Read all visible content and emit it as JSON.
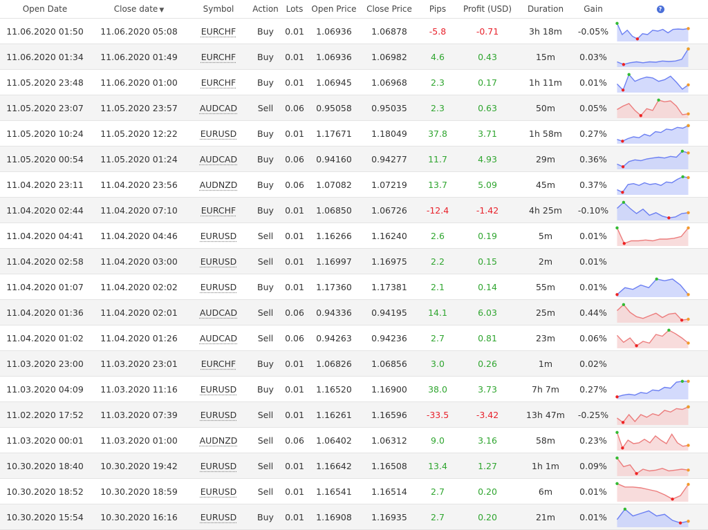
{
  "headers": {
    "open_date": "Open Date",
    "close_date": "Close date",
    "close_sort_icon": "triangle-down",
    "symbol": "Symbol",
    "action": "Action",
    "lots": "Lots",
    "open_price": "Open Price",
    "close_price": "Close Price",
    "pips": "Pips",
    "profit": "Profit (USD)",
    "duration": "Duration",
    "gain": "Gain",
    "help_icon": "?"
  },
  "colors": {
    "positive": "#2fa52f",
    "negative": "#e8212b",
    "buy_line": "#6b7ff2",
    "buy_fill": "#c4cdfb",
    "sell_line": "#ec7c7c",
    "sell_fill": "#f6d0d0",
    "start_marker_buy": "#ee3333",
    "high_marker": "#33bb33",
    "low_marker": "#ee2222",
    "end_marker": "#f39a2c"
  },
  "trades": [
    {
      "open": "11.06.2020 01:50",
      "close": "11.06.2020 05:08",
      "symbol": "EURCHF",
      "action": "Buy",
      "lots": "0.01",
      "open_price": "1.06936",
      "close_price": "1.06878",
      "pips": "-5.8",
      "profit": "-0.71",
      "duration": "3h 18m",
      "gain": "-0.05%",
      "spark": [
        0.95,
        0.3,
        0.55,
        0.2,
        0.05,
        0.35,
        0.3,
        0.55,
        0.5,
        0.6,
        0.4,
        0.6,
        0.62,
        0.6,
        0.65
      ]
    },
    {
      "open": "11.06.2020 01:34",
      "close": "11.06.2020 01:49",
      "symbol": "EURCHF",
      "action": "Buy",
      "lots": "0.01",
      "open_price": "1.06936",
      "close_price": "1.06982",
      "pips": "4.6",
      "profit": "0.43",
      "duration": "15m",
      "gain": "0.03%",
      "spark": [
        0.2,
        0.05,
        0.15,
        0.2,
        0.15,
        0.2,
        0.18,
        0.25,
        0.22,
        0.25,
        0.35,
        0.95
      ]
    },
    {
      "open": "11.05.2020 23:48",
      "close": "11.06.2020 01:00",
      "symbol": "EURCHF",
      "action": "Buy",
      "lots": "0.01",
      "open_price": "1.06945",
      "close_price": "1.06968",
      "pips": "2.3",
      "profit": "0.17",
      "duration": "1h 11m",
      "gain": "0.01%",
      "spark": [
        0.4,
        0.05,
        0.95,
        0.55,
        0.7,
        0.8,
        0.75,
        0.55,
        0.65,
        0.85,
        0.5,
        0.1,
        0.35
      ]
    },
    {
      "open": "11.05.2020 23:07",
      "close": "11.05.2020 23:57",
      "symbol": "AUDCAD",
      "action": "Sell",
      "lots": "0.06",
      "open_price": "0.95058",
      "close_price": "0.95035",
      "pips": "2.3",
      "profit": "0.63",
      "duration": "50m",
      "gain": "0.05%",
      "spark": [
        0.4,
        0.6,
        0.75,
        0.35,
        0.05,
        0.45,
        0.35,
        0.95,
        0.85,
        0.9,
        0.6,
        0.1,
        0.15
      ]
    },
    {
      "open": "11.05.2020 10:24",
      "close": "11.05.2020 12:22",
      "symbol": "EURUSD",
      "action": "Buy",
      "lots": "0.01",
      "open_price": "1.17671",
      "close_price": "1.18049",
      "pips": "37.8",
      "profit": "3.71",
      "duration": "1h 58m",
      "gain": "0.27%",
      "spark": [
        0.15,
        0.05,
        0.2,
        0.3,
        0.25,
        0.45,
        0.35,
        0.6,
        0.55,
        0.75,
        0.7,
        0.85,
        0.8,
        0.95
      ]
    },
    {
      "open": "11.05.2020 00:54",
      "close": "11.05.2020 01:24",
      "symbol": "AUDCAD",
      "action": "Buy",
      "lots": "0.06",
      "open_price": "0.94160",
      "close_price": "0.94277",
      "pips": "11.7",
      "profit": "4.93",
      "duration": "29m",
      "gain": "0.36%",
      "spark": [
        0.2,
        0.05,
        0.35,
        0.45,
        0.4,
        0.5,
        0.55,
        0.6,
        0.55,
        0.65,
        0.6,
        0.95,
        0.85
      ]
    },
    {
      "open": "11.04.2020 23:11",
      "close": "11.04.2020 23:56",
      "symbol": "AUDNZD",
      "action": "Buy",
      "lots": "0.06",
      "open_price": "1.07082",
      "close_price": "1.07219",
      "pips": "13.7",
      "profit": "5.09",
      "duration": "45m",
      "gain": "0.37%",
      "spark": [
        0.2,
        0.05,
        0.5,
        0.55,
        0.45,
        0.6,
        0.5,
        0.55,
        0.45,
        0.65,
        0.6,
        0.8,
        0.95,
        0.9
      ]
    },
    {
      "open": "11.04.2020 02:44",
      "close": "11.04.2020 07:10",
      "symbol": "EURCHF",
      "action": "Buy",
      "lots": "0.01",
      "open_price": "1.06850",
      "close_price": "1.06726",
      "pips": "-12.4",
      "profit": "-1.42",
      "duration": "4h 25m",
      "gain": "-0.10%",
      "spark": [
        0.6,
        0.95,
        0.6,
        0.3,
        0.55,
        0.2,
        0.35,
        0.15,
        0.05,
        0.1,
        0.3,
        0.35
      ]
    },
    {
      "open": "11.04.2020 04:41",
      "close": "11.04.2020 04:46",
      "symbol": "EURUSD",
      "action": "Sell",
      "lots": "0.01",
      "open_price": "1.16266",
      "close_price": "1.16240",
      "pips": "2.6",
      "profit": "0.19",
      "duration": "5m",
      "gain": "0.01%",
      "spark": [
        0.95,
        0.05,
        0.2,
        0.2,
        0.25,
        0.2,
        0.3,
        0.3,
        0.35,
        0.45,
        0.95
      ]
    },
    {
      "open": "11.04.2020 02:58",
      "close": "11.04.2020 03:00",
      "symbol": "EURUSD",
      "action": "Sell",
      "lots": "0.01",
      "open_price": "1.16997",
      "close_price": "1.16975",
      "pips": "2.2",
      "profit": "0.15",
      "duration": "2m",
      "gain": "0.01%",
      "spark": null
    },
    {
      "open": "11.04.2020 01:07",
      "close": "11.04.2020 02:02",
      "symbol": "EURUSD",
      "action": "Buy",
      "lots": "0.01",
      "open_price": "1.17360",
      "close_price": "1.17381",
      "pips": "2.1",
      "profit": "0.14",
      "duration": "55m",
      "gain": "0.01%",
      "spark": [
        0.05,
        0.45,
        0.35,
        0.6,
        0.45,
        0.95,
        0.85,
        0.95,
        0.6,
        0.05
      ]
    },
    {
      "open": "11.04.2020 01:36",
      "close": "11.04.2020 02:01",
      "symbol": "AUDCAD",
      "action": "Sell",
      "lots": "0.06",
      "open_price": "0.94336",
      "close_price": "0.94195",
      "pips": "14.1",
      "profit": "6.03",
      "duration": "25m",
      "gain": "0.44%",
      "spark": [
        0.6,
        0.95,
        0.5,
        0.25,
        0.15,
        0.3,
        0.45,
        0.2,
        0.4,
        0.45,
        0.05,
        0.1
      ]
    },
    {
      "open": "11.04.2020 01:02",
      "close": "11.04.2020 01:26",
      "symbol": "AUDCAD",
      "action": "Sell",
      "lots": "0.06",
      "open_price": "0.94263",
      "close_price": "0.94236",
      "pips": "2.7",
      "profit": "0.81",
      "duration": "23m",
      "gain": "0.06%",
      "spark": [
        0.65,
        0.25,
        0.5,
        0.05,
        0.3,
        0.2,
        0.7,
        0.6,
        0.95,
        0.75,
        0.5,
        0.2
      ]
    },
    {
      "open": "11.03.2020 23:00",
      "close": "11.03.2020 23:01",
      "symbol": "EURCHF",
      "action": "Buy",
      "lots": "0.01",
      "open_price": "1.06826",
      "close_price": "1.06856",
      "pips": "3.0",
      "profit": "0.26",
      "duration": "1m",
      "gain": "0.02%",
      "spark": null
    },
    {
      "open": "11.03.2020 04:09",
      "close": "11.03.2020 11:16",
      "symbol": "EURUSD",
      "action": "Buy",
      "lots": "0.01",
      "open_price": "1.16520",
      "close_price": "1.16900",
      "pips": "38.0",
      "profit": "3.73",
      "duration": "7h 7m",
      "gain": "0.27%",
      "spark": [
        0.05,
        0.15,
        0.2,
        0.15,
        0.3,
        0.25,
        0.45,
        0.4,
        0.6,
        0.55,
        0.9,
        0.95,
        0.95
      ]
    },
    {
      "open": "11.02.2020 17:52",
      "close": "11.03.2020 07:39",
      "symbol": "EURUSD",
      "action": "Sell",
      "lots": "0.01",
      "open_price": "1.16261",
      "close_price": "1.16596",
      "pips": "-33.5",
      "profit": "-3.42",
      "duration": "13h 47m",
      "gain": "-0.25%",
      "spark": [
        0.3,
        0.05,
        0.5,
        0.1,
        0.5,
        0.35,
        0.55,
        0.45,
        0.75,
        0.65,
        0.85,
        0.8,
        0.95
      ]
    },
    {
      "open": "11.03.2020 00:01",
      "close": "11.03.2020 01:00",
      "symbol": "AUDNZD",
      "action": "Sell",
      "lots": "0.06",
      "open_price": "1.06402",
      "close_price": "1.06312",
      "pips": "9.0",
      "profit": "3.16",
      "duration": "58m",
      "gain": "0.23%",
      "spark": [
        0.95,
        0.05,
        0.5,
        0.3,
        0.35,
        0.55,
        0.35,
        0.75,
        0.5,
        0.3,
        0.85,
        0.35,
        0.15,
        0.2
      ]
    },
    {
      "open": "10.30.2020 18:40",
      "close": "10.30.2020 19:42",
      "symbol": "EURUSD",
      "action": "Sell",
      "lots": "0.01",
      "open_price": "1.16642",
      "close_price": "1.16508",
      "pips": "13.4",
      "profit": "1.27",
      "duration": "1h 1m",
      "gain": "0.09%",
      "spark": [
        0.95,
        0.45,
        0.55,
        0.05,
        0.3,
        0.2,
        0.25,
        0.35,
        0.2,
        0.25,
        0.3,
        0.25
      ]
    },
    {
      "open": "10.30.2020 18:52",
      "close": "10.30.2020 18:59",
      "symbol": "EURUSD",
      "action": "Sell",
      "lots": "0.01",
      "open_price": "1.16541",
      "close_price": "1.16514",
      "pips": "2.7",
      "profit": "0.20",
      "duration": "6m",
      "gain": "0.01%",
      "spark": [
        0.95,
        0.75,
        0.75,
        0.7,
        0.6,
        0.5,
        0.3,
        0.05,
        0.25,
        0.9
      ]
    },
    {
      "open": "10.30.2020 15:54",
      "close": "10.30.2020 16:16",
      "symbol": "EURUSD",
      "action": "Buy",
      "lots": "0.01",
      "open_price": "1.16908",
      "close_price": "1.16935",
      "pips": "2.7",
      "profit": "0.20",
      "duration": "21m",
      "gain": "0.01%",
      "spark": [
        0.35,
        0.95,
        0.55,
        0.7,
        0.85,
        0.55,
        0.65,
        0.3,
        0.15,
        0.25
      ]
    }
  ]
}
